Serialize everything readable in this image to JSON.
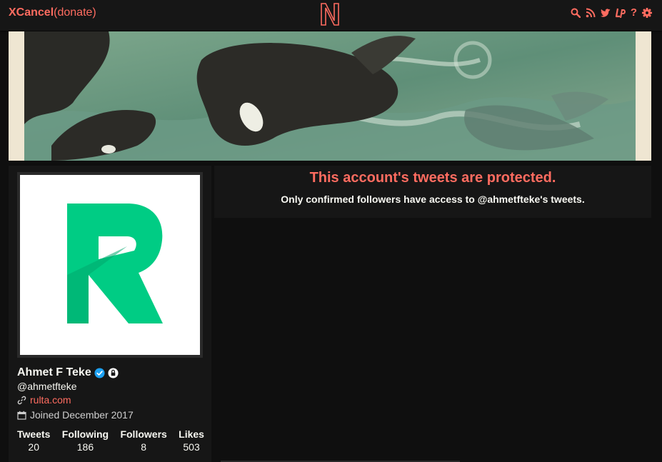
{
  "nav": {
    "brand": "XCancel",
    "donate": "(donate)",
    "icons": [
      "search-icon",
      "rss-icon",
      "twitter-icon",
      "liberapay-icon",
      "help-icon",
      "gear-icon"
    ],
    "help_label": "?"
  },
  "profile": {
    "fullname": "Ahmet F Teke",
    "username": "@ahmetfteke",
    "website": "rulta.com",
    "joined": "Joined December 2017",
    "verified": true,
    "protected": true,
    "stats": [
      {
        "label": "Tweets",
        "value": "20"
      },
      {
        "label": "Following",
        "value": "186"
      },
      {
        "label": "Followers",
        "value": "8"
      },
      {
        "label": "Likes",
        "value": "503"
      }
    ]
  },
  "timeline": {
    "protected_title": "This account's tweets are protected.",
    "protected_message": "Only confirmed followers have access to @ahmetfteke's tweets."
  },
  "colors": {
    "accent": "#ff6c60",
    "background": "#0f0f0f",
    "panel": "#161616",
    "avatar_logo": "#00cc84",
    "verified_blue": "#1da1f2"
  }
}
